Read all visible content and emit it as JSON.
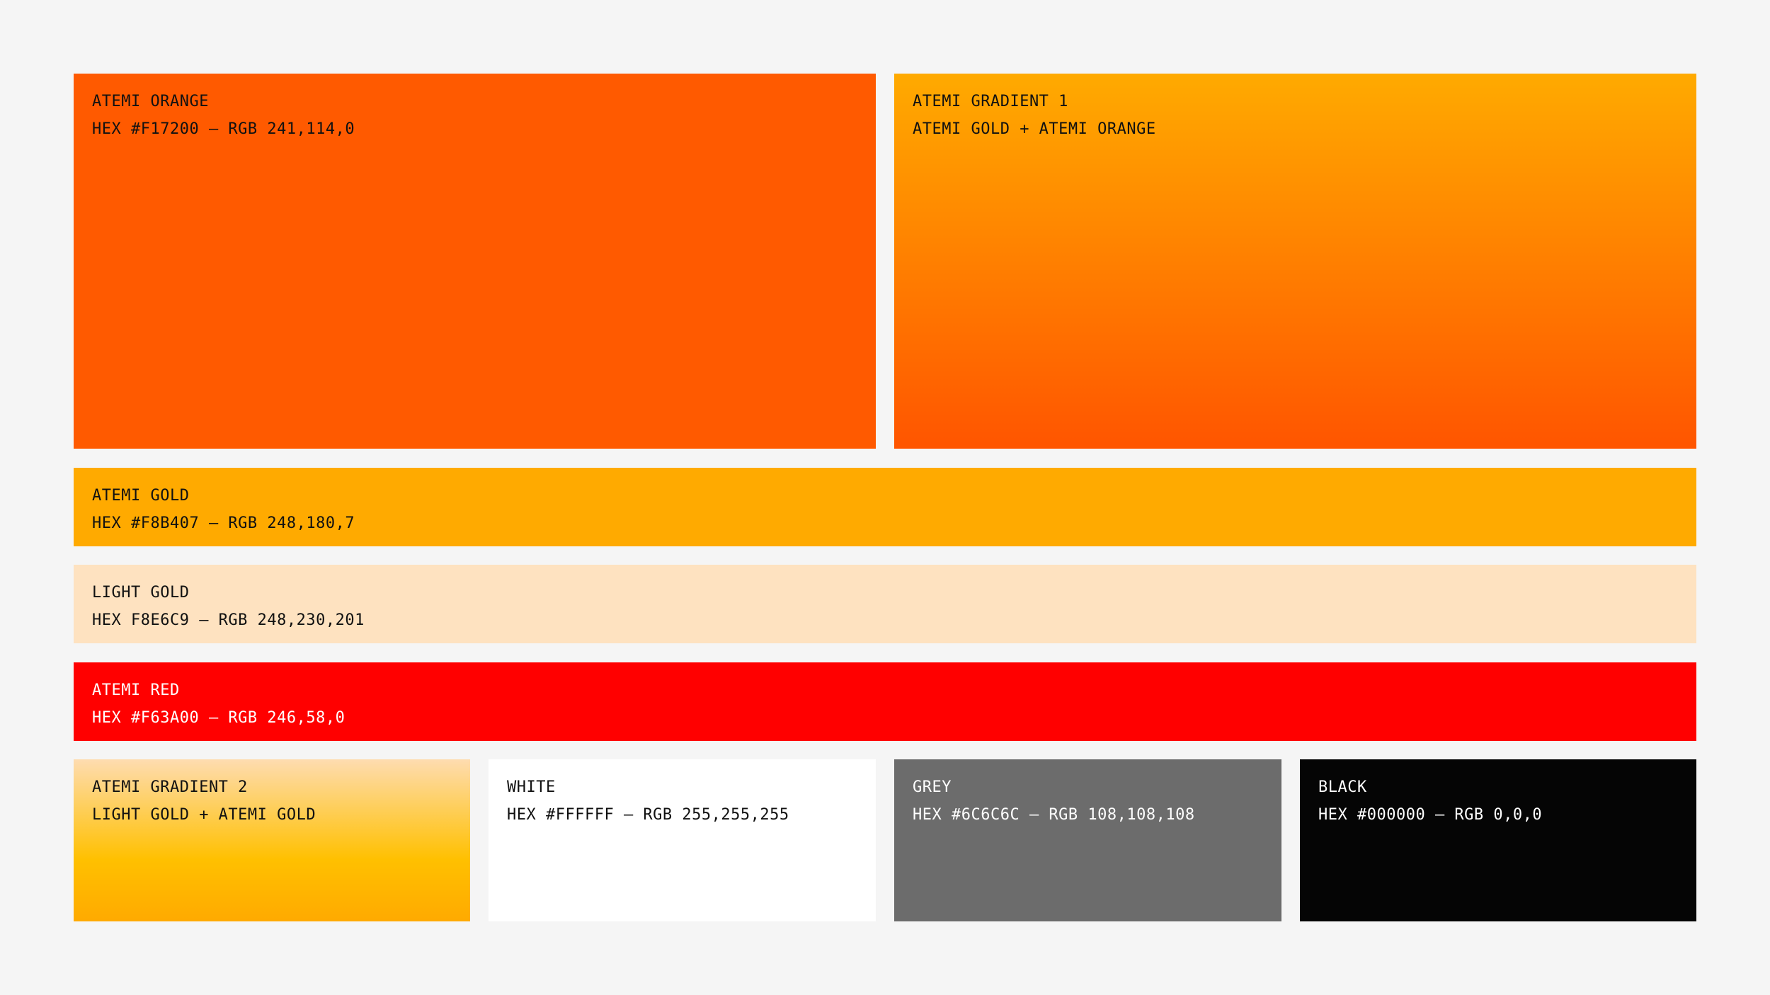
{
  "swatches": {
    "orange": {
      "name": "ATEMI ORANGE",
      "spec": "HEX #F17200 – RGB 241,114,0",
      "color": "#FF5A00"
    },
    "gradient_1": {
      "name": "ATEMI GRADIENT 1",
      "spec": "ATEMI GOLD + ATEMI ORANGE",
      "color_top": "#FFAA00",
      "color_bottom": "#FF5500"
    },
    "gold": {
      "name": "ATEMI GOLD",
      "spec": "HEX #F8B407 – RGB 248,180,7",
      "color": "#FFAA00"
    },
    "light_gold": {
      "name": "LIGHT GOLD",
      "spec": "HEX F8E6C9 – RGB 248,230,201",
      "color": "#FEE2C0"
    },
    "red": {
      "name": "ATEMI RED",
      "spec": "HEX #F63A00 – RGB 246,58,0",
      "color": "#FF0000"
    },
    "gradient_2": {
      "name": "ATEMI GRADIENT 2",
      "spec": "LIGHT GOLD + ATEMI GOLD",
      "color_top": "#FEDCB0",
      "color_mid": "#FFC000",
      "color_bottom": "#FFAA00"
    },
    "white": {
      "name": "WHITE",
      "spec": "HEX #FFFFFF – RGB 255,255,255",
      "color": "#FFFFFF"
    },
    "grey": {
      "name": "GREY",
      "spec": "HEX #6C6C6C – RGB 108,108,108",
      "color": "#6C6C6C"
    },
    "black": {
      "name": "BLACK",
      "spec": "HEX #000000 – RGB 0,0,0",
      "color": "#050505"
    }
  }
}
